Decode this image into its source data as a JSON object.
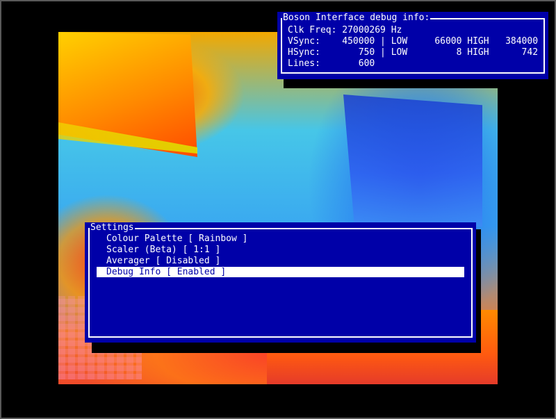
{
  "debug": {
    "title": "Boson Interface debug info:",
    "clk_freq": "Clk Freq: 27000269 Hz",
    "vsync": "VSync:    450000 | LOW     66000 HIGH   384000",
    "hsync": "HSync:       750 | LOW         8 HIGH      742",
    "lines": "Lines:       600"
  },
  "settings": {
    "title": "Settings",
    "items": [
      {
        "label": "Colour Palette [ Rainbow ]"
      },
      {
        "label": "Scaler (Beta) [ 1:1 ]"
      },
      {
        "label": "Averager [ Disabled ]"
      },
      {
        "label": "Debug Info [ Enabled ]"
      }
    ],
    "selected_index": 3
  },
  "colors": {
    "panel_blue": "#0000a8",
    "text_white": "#ffffff",
    "highlight": "#ffffff"
  }
}
